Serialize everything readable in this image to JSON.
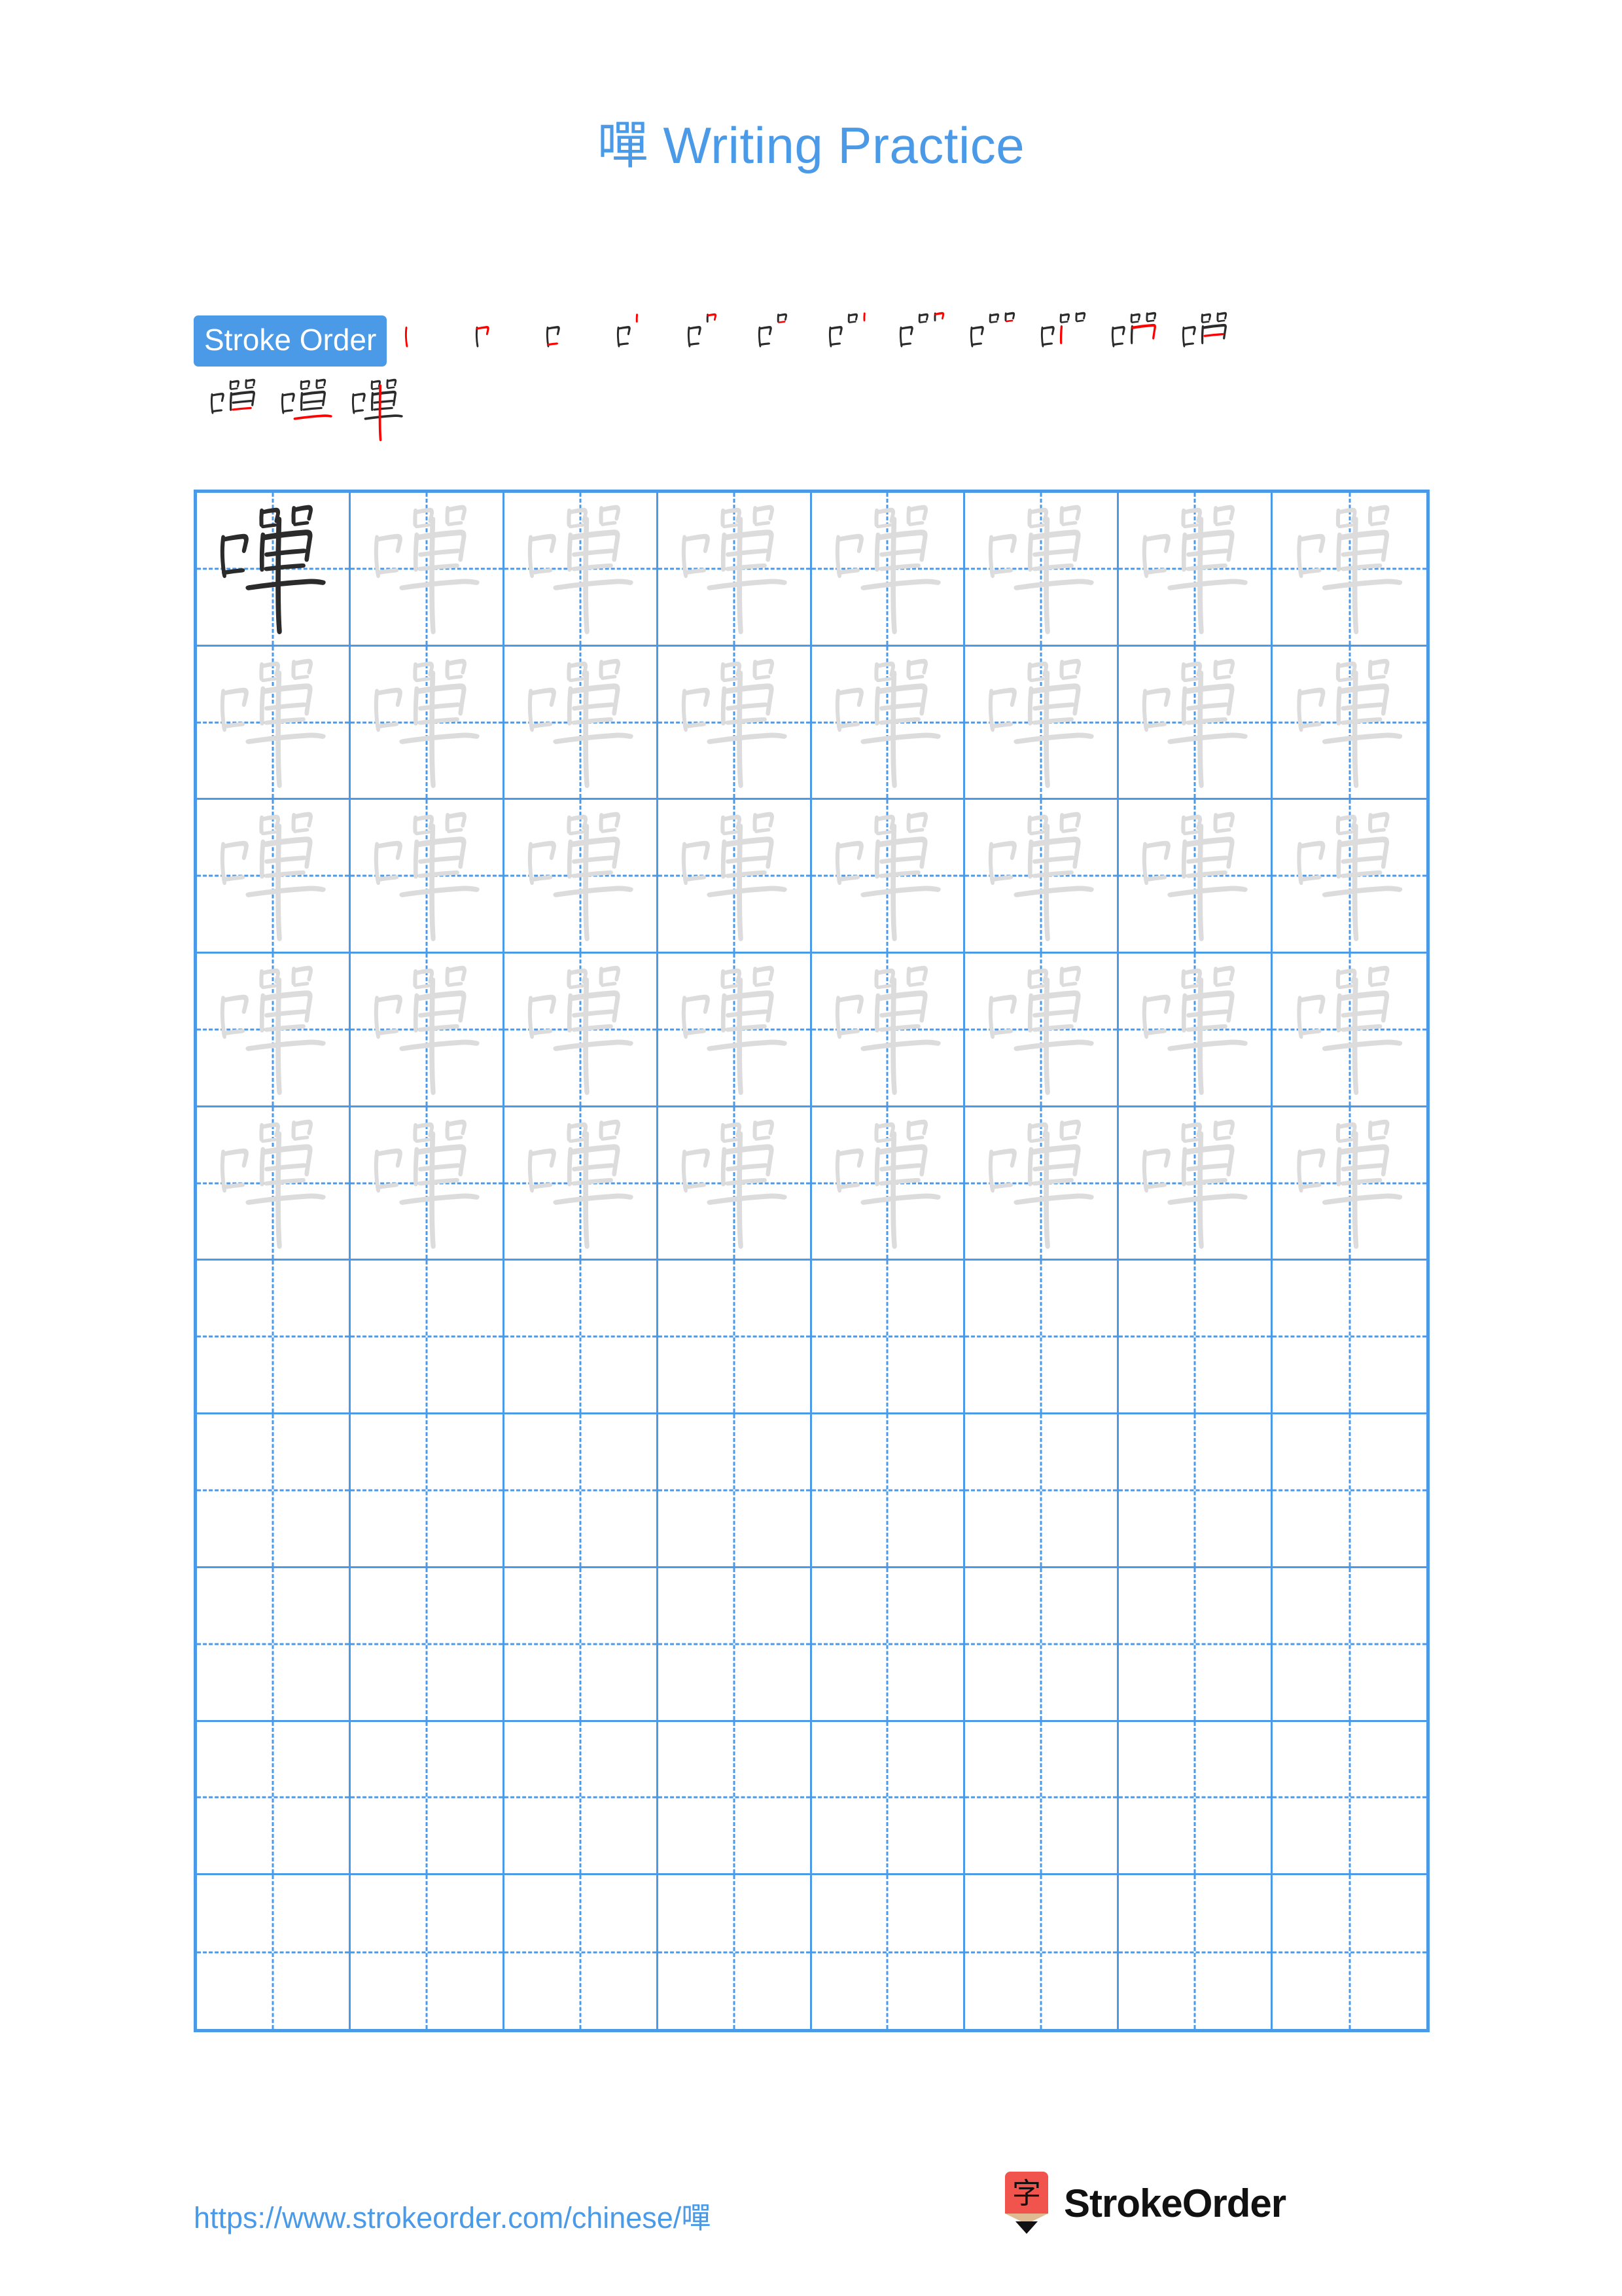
{
  "page": {
    "title_char": "嘽",
    "title_text": " Writing Practice",
    "accent_color": "#4a9ae8",
    "stroke_new_color": "#ff0000",
    "stroke_done_color": "#2b2b2b",
    "trace_color": "#dcdcdc"
  },
  "stroke_order": {
    "badge_label": "Stroke Order",
    "total_strokes": 15,
    "steps": [
      {
        "index": 1,
        "strokes_shown": 1
      },
      {
        "index": 2,
        "strokes_shown": 2
      },
      {
        "index": 3,
        "strokes_shown": 3
      },
      {
        "index": 4,
        "strokes_shown": 4
      },
      {
        "index": 5,
        "strokes_shown": 5
      },
      {
        "index": 6,
        "strokes_shown": 6
      },
      {
        "index": 7,
        "strokes_shown": 7
      },
      {
        "index": 8,
        "strokes_shown": 8
      },
      {
        "index": 9,
        "strokes_shown": 9
      },
      {
        "index": 10,
        "strokes_shown": 10
      },
      {
        "index": 11,
        "strokes_shown": 11
      },
      {
        "index": 12,
        "strokes_shown": 12
      },
      {
        "index": 13,
        "strokes_shown": 13
      },
      {
        "index": 14,
        "strokes_shown": 14
      },
      {
        "index": 15,
        "strokes_shown": 15
      }
    ]
  },
  "practice_grid": {
    "character": "嘽",
    "columns": 8,
    "rows": 10,
    "solid_cells": 1,
    "trace_cells": 39,
    "blank_cells": 40
  },
  "footer": {
    "url": "https://www.strokeorder.com/chinese/嘽",
    "logo_char": "字",
    "logo_text": "StrokeOrder",
    "logo_color": "#f0544c"
  }
}
